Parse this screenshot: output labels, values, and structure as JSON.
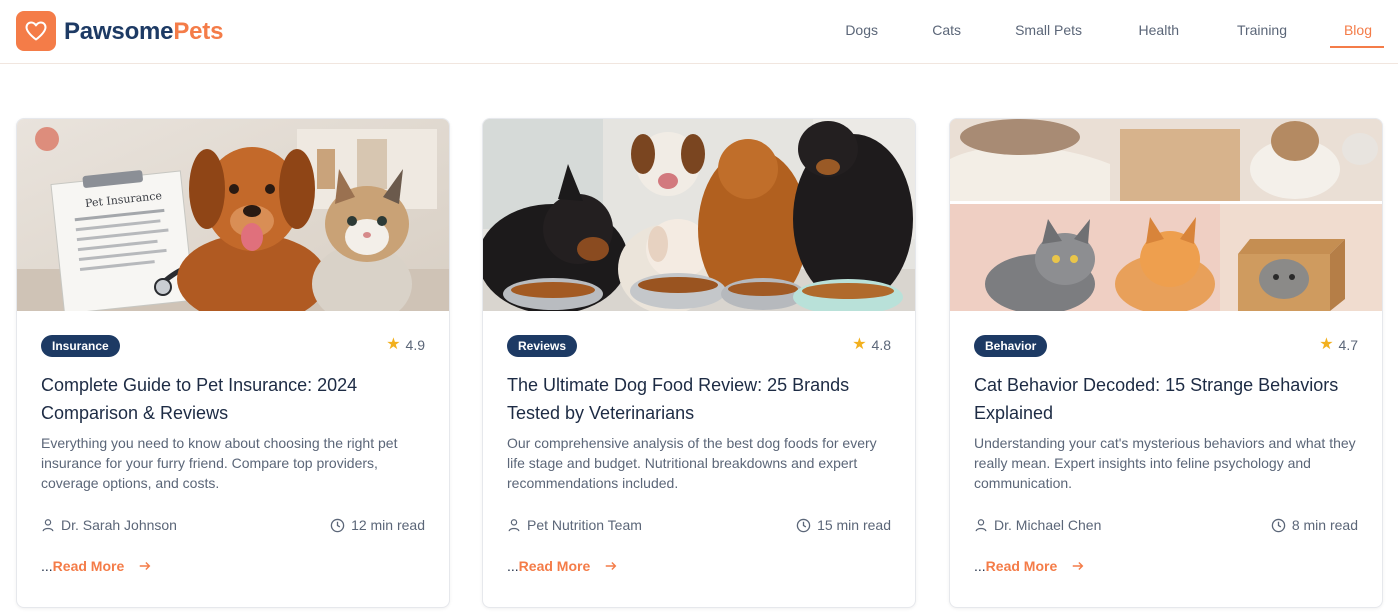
{
  "brand": {
    "part1": "Pawsome",
    "part2": "Pets"
  },
  "nav": [
    {
      "label": "Dogs"
    },
    {
      "label": "Cats"
    },
    {
      "label": "Small Pets"
    },
    {
      "label": "Health"
    },
    {
      "label": "Training"
    },
    {
      "label": "Blog",
      "active": true
    }
  ],
  "cards": [
    {
      "category": "Insurance",
      "rating": "4.9",
      "title": "Complete Guide to Pet Insurance: 2024 Comparison & Reviews",
      "description": "Everything you need to know about choosing the right pet insurance for your furry friend. Compare top providers, coverage options, and costs.",
      "author": "Dr. Sarah Johnson",
      "read_time": "12 min read",
      "read_more": "Read More",
      "image_text": "Pet Insurance"
    },
    {
      "category": "Reviews",
      "rating": "4.8",
      "title": "The Ultimate Dog Food Review: 25 Brands Tested by Veterinarians",
      "description": "Our comprehensive analysis of the best dog foods for every life stage and budget. Nutritional breakdowns and expert recommendations included.",
      "author": "Pet Nutrition Team",
      "read_time": "15 min read",
      "read_more": "Read More"
    },
    {
      "category": "Behavior",
      "rating": "4.7",
      "title": "Cat Behavior Decoded: 15 Strange Behaviors Explained",
      "description": "Understanding your cat's mysterious behaviors and what they really mean. Expert insights into feline psychology and communication.",
      "author": "Dr. Michael Chen",
      "read_time": "8 min read",
      "read_more": "Read More"
    }
  ],
  "colors": {
    "accent": "#f47c48",
    "navy": "#1d3a64",
    "star": "#f2b01e"
  }
}
